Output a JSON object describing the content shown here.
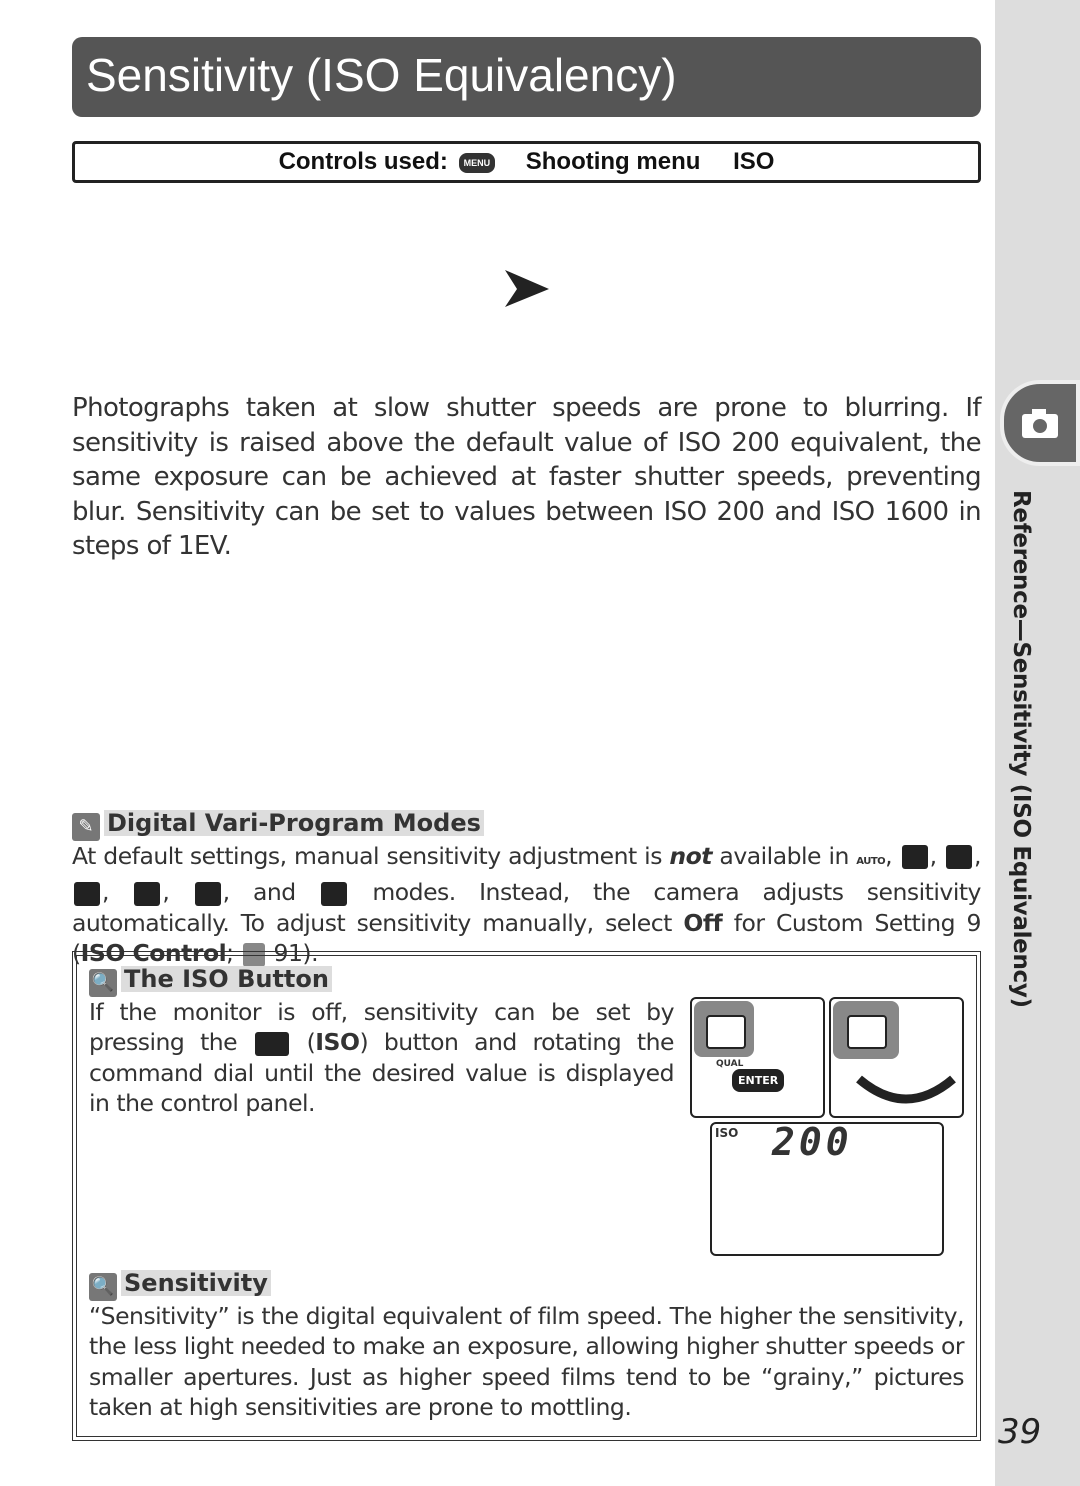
{
  "title": "Sensitivity (ISO Equivalency)",
  "controls": {
    "label": "Controls used:",
    "menu_icon": "MENU",
    "path": "Shooting menu",
    "item": "ISO"
  },
  "arrow_icon": "play-arrow-icon",
  "intro": "Photographs taken at slow shutter speeds are prone to blurring.  If sensitivity is raised above the default value of ISO 200 equivalent, the same exposure can be achieved at faster shutter speeds, preventing blur.  Sensitivity can be set to values between ISO 200 and ISO 1600 in steps of 1EV.",
  "vari": {
    "heading": "Digital Vari-Program Modes",
    "t1": "At default settings, manual sensitivity adjustment is ",
    "em": "not",
    "t2": " available in ",
    "auto": "AUTO",
    "t3": ", and ",
    "t4": " modes.  Instead, the camera adjusts sensitivity automatically.  To adjust sensitivity manually, select ",
    "off": "Off",
    "t5": " for Custom Setting 9 (",
    "iso_control": "ISO Control",
    "t6": "; ",
    "page": " 91)."
  },
  "iso_button": {
    "heading": "The ISO Button",
    "t1": "If the monitor is off, sensitivity can be set by pressing the ",
    "iso": "ISO",
    "t2": " button and rotating the command dial until the desired value is displayed in the control panel.",
    "qual": "QUAL",
    "enter": "ENTER",
    "lcd_label": "ISO",
    "lcd_value": "200"
  },
  "sensitivity": {
    "heading": "Sensitivity",
    "text": "“Sensitivity” is the digital equivalent of film speed.  The higher the sensitivity, the less light needed to make an exposure, allowing higher shutter speeds or smaller apertures.  Just as higher speed films tend to be “grainy,” pictures taken at high sensitivities are prone to mottling."
  },
  "sidebar": {
    "section": "Reference—Sensitivity (ISO Equivalency)",
    "icon": "camera-icon"
  },
  "page_number": "39"
}
